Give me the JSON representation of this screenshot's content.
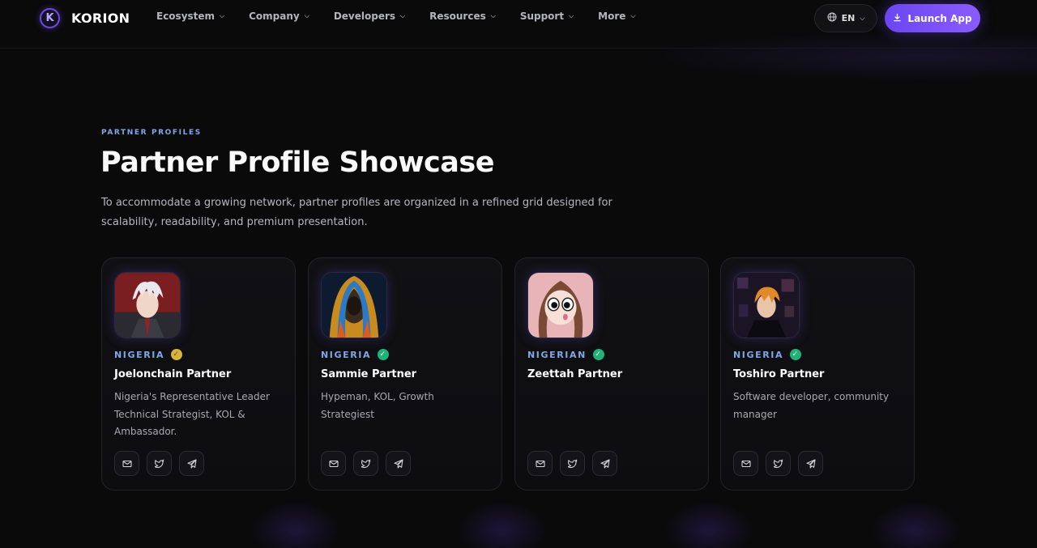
{
  "brand": {
    "logo_letter": "K",
    "name": "KORION"
  },
  "nav": {
    "items": [
      {
        "label": "Ecosystem"
      },
      {
        "label": "Company"
      },
      {
        "label": "Developers"
      },
      {
        "label": "Resources"
      },
      {
        "label": "Support"
      },
      {
        "label": "More"
      }
    ],
    "language": "EN",
    "launch_label": "Launch App"
  },
  "hero": {
    "eyebrow": "PARTNER PROFILES",
    "title": "Partner Profile Showcase",
    "description": "To accommodate a growing network, partner profiles are organized in a refined grid designed for scalability, readability, and premium presentation."
  },
  "partners": [
    {
      "country": "NIGERIA",
      "badge": "gold",
      "name": "Joelonchain Partner",
      "role": "Nigeria's Representative Leader Technical Strategist, KOL & Ambassador."
    },
    {
      "country": "NIGERIA",
      "badge": "green",
      "name": "Sammie Partner",
      "role": "Hypeman, KOL, Growth Strategiest"
    },
    {
      "country": "NIGERIAN",
      "badge": "green",
      "name": "Zeettah Partner",
      "role": ""
    },
    {
      "country": "NIGERIA",
      "badge": "green",
      "name": "Toshiro Partner",
      "role": "Software developer, community manager"
    }
  ],
  "colors": {
    "accent": "#7b52f7",
    "eyebrow": "#7fa7e8",
    "verified_green": "#1fb37a",
    "verified_gold": "#d8b43a",
    "background": "#0a0a0b"
  },
  "icons": {
    "social": [
      "mail-icon",
      "twitter-icon",
      "telegram-icon"
    ],
    "badge_gold": "check-badge-icon",
    "badge_green": "check-circle-icon"
  }
}
